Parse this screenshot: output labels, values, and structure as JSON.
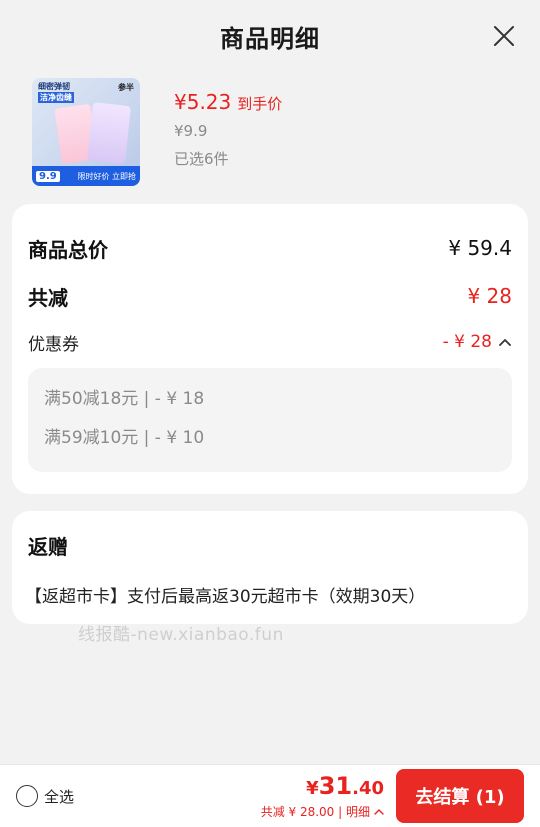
{
  "header": {
    "title": "商品明细"
  },
  "product": {
    "thumb_top_text": "细密弹韧",
    "thumb_top_text2": "洁净齿缝",
    "thumb_brand": "参半",
    "thumb_price": "9.9",
    "thumb_badge": "限时好价 立即抢",
    "price": "¥5.23",
    "price_tag": "到手价",
    "original_price": "¥9.9",
    "selected": "已选6件"
  },
  "summary": {
    "total_label": "商品总价",
    "total_value": "¥ 59.4",
    "reduce_label": "共减",
    "reduce_value": "¥ 28",
    "coupon_label": "优惠券",
    "coupon_value": "- ¥ 28",
    "coupon_items": [
      "满50减18元 | - ¥ 18",
      "满59减10元 | - ¥ 10"
    ]
  },
  "gift": {
    "title": "返赠",
    "desc": "【返超市卡】支付后最高返30元超市卡（效期30天）"
  },
  "watermark": "线报酷-new.xianbao.fun",
  "bottom": {
    "select_all": "全选",
    "yen": "¥",
    "price_int": "31",
    "price_dec": ".40",
    "sub_text": "共减 ¥ 28.00 | 明细",
    "checkout": "去结算 (1)"
  },
  "colors": {
    "accent": "#e8231f",
    "checkout_bg": "#ea2a24"
  },
  "icons": [
    "close-icon",
    "chevron-up-icon",
    "radio-icon"
  ]
}
